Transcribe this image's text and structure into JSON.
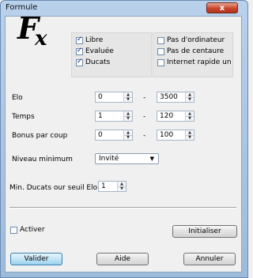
{
  "window": {
    "title": "Formule",
    "close_label": "x"
  },
  "logo": {
    "letter_main": "F",
    "letter_sub": "x"
  },
  "options_left": [
    {
      "label": "Libre",
      "checked": true
    },
    {
      "label": "Evaluée",
      "checked": true
    },
    {
      "label": "Ducats",
      "checked": true
    }
  ],
  "options_right": [
    {
      "label": "Pas d'ordinateur",
      "checked": false
    },
    {
      "label": "Pas de centaure",
      "checked": false
    },
    {
      "label": "Internet rapide uniqu",
      "checked": false
    }
  ],
  "ranges": [
    {
      "label": "Elo",
      "min": "0",
      "max": "3500"
    },
    {
      "label": "Temps",
      "min": "1",
      "max": "120"
    },
    {
      "label": "Bonus par coup",
      "min": "0",
      "max": "100"
    }
  ],
  "range_separator": "-",
  "niveau": {
    "label": "Niveau minimum",
    "value": "Invité"
  },
  "ducats": {
    "label": "Min. Ducats  our seuil Elo",
    "value": "1"
  },
  "activer": {
    "label": "Activer",
    "checked": false
  },
  "buttons": {
    "initialiser": "Initialiser",
    "valider": "Valider",
    "aide": "Aide",
    "annuler": "Annuler"
  }
}
